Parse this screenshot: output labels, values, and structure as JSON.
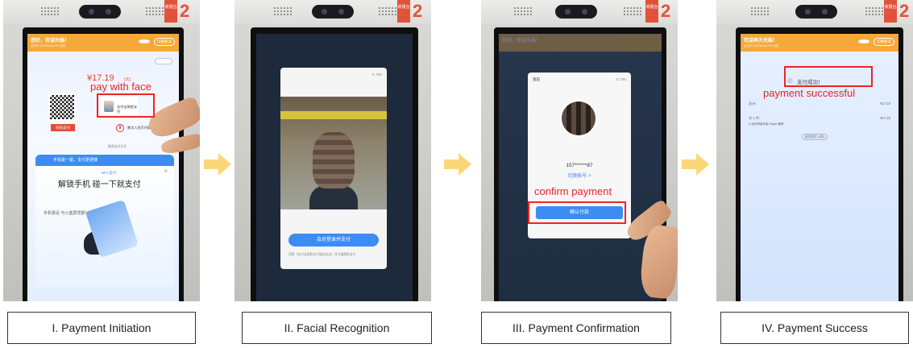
{
  "counter_number": "2",
  "counter_tag": "收银台",
  "panels": [
    {
      "caption": "I. Payment Initiation",
      "annotation": "pay with face",
      "screen": {
        "header_title": "您好，欢迎光临！",
        "header_sub": "会员号 2023060001234 优惠",
        "header_button": "切换账号",
        "price": "¥17.19",
        "price_unit": "(元)",
        "qr_button": "扫码支付",
        "face_pay_label": "支付宝刷脸支付",
        "ecny_label": "数字人民币付款码",
        "more_label": "更多支付方式",
        "tap_banner": "手机碰一碰，支付更便捷",
        "nfc_label": "NFC支付",
        "tap_title": "解锁手机 碰一下就支付",
        "tap_hint": "手机靠近 与小蓝屏顶部对齐",
        "close": "×"
      }
    },
    {
      "caption": "II. Facial Recognition",
      "screen": {
        "timer": "X 78S",
        "member_button": "会员登录并支付",
        "agreement": "同意《支付宝刷脸支付服务协议》并开通刷脸支付"
      }
    },
    {
      "caption": "III. Payment Confirmation",
      "annotation": "confirm payment",
      "screen": {
        "top_left": "蜜田",
        "timer": "X 78S",
        "account": "157******87",
        "switch_account": "切换账号 >",
        "confirm_button": "确认付款"
      }
    },
    {
      "caption": "IV. Payment Success",
      "annotation": "payment successful",
      "screen": {
        "header_title": "欢迎再次光临！",
        "header_button": "切换账号",
        "success_text": "支付成功！",
        "total_label": "总计:",
        "total_value": "¥17.19",
        "items_label": "共 1 件:",
        "item_name": "小龙虾鲜香拌面 Staple 套餐",
        "item_value": "¥17.19",
        "back_button": "返回首页 (3秒)"
      }
    }
  ],
  "colors": {
    "annotation_red": "#ee2424",
    "arrow_yellow": "#fcd67a",
    "header_orange": "#f4a93a",
    "button_blue": "#3d8cf4"
  }
}
